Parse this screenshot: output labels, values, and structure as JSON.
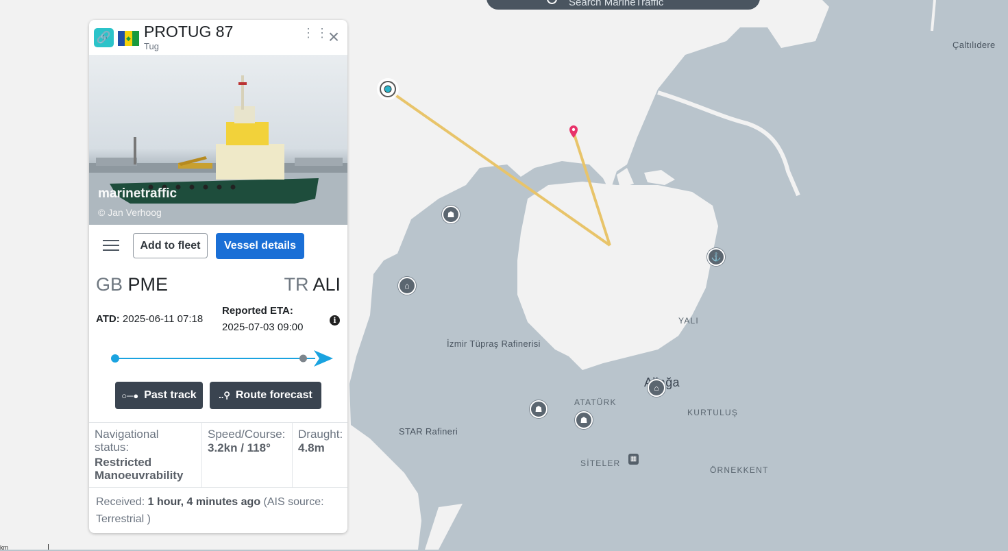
{
  "search": {
    "placeholder": "Search MarineTraffic"
  },
  "vessel": {
    "name": "PROTUG 87",
    "type": "Tug",
    "photo_watermark": "marinetraffic",
    "photo_credit": "© Jan Verhoog"
  },
  "toolbar": {
    "add_to_fleet": "Add to fleet",
    "vessel_details": "Vessel details"
  },
  "voyage": {
    "departure_country": "GB",
    "departure_port": "PME",
    "arrival_country": "TR",
    "arrival_port": "ALI",
    "atd_label": "ATD:",
    "atd_value": "2025-06-11 07:18",
    "eta_label": "Reported ETA:",
    "eta_value": "2025-07-03 09:00",
    "progress_fraction": 0.94
  },
  "actions": {
    "past_track": "Past track",
    "route_forecast": "Route forecast"
  },
  "stats": {
    "nav_status_label": "Navigational status:",
    "nav_status_value": "Restricted Manoeuvrability",
    "speed_label": "Speed/Course:",
    "speed_value": "3.2kn / 118°",
    "draught_label": "Draught:",
    "draught_value": "4.8m"
  },
  "received": {
    "prefix": "Received:",
    "time": "1 hour, 4 minutes ago",
    "source": "(AIS source: Terrestrial )"
  },
  "map": {
    "places": {
      "caltilidere": "Çaltılıdere",
      "yali": "YALI",
      "tupras": "İzmir Tüpraş Rafinerisi",
      "aliaga": "Aliağa",
      "ataturk": "ATATÜRK",
      "kurtulus": "KURTULUŞ",
      "star": "STAR Rafineri",
      "siteler": "SİTELER",
      "ornekkent": "ÖRNEKKENT"
    },
    "scale_label": "km"
  },
  "colors": {
    "land": "#f2f2f2",
    "sea": "#b9c4cc",
    "track": "#e8c46a",
    "accent": "#1a6fd6",
    "progress": "#1aa3e0"
  }
}
